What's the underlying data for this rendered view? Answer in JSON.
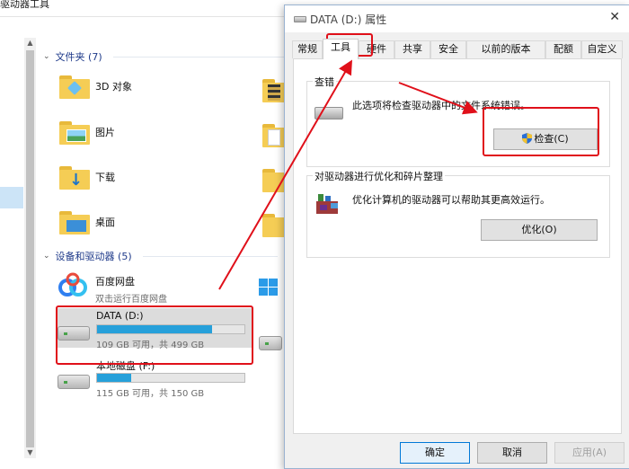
{
  "explorer": {
    "title": "驱动器工具",
    "folders_header": "文件夹 (7)",
    "folders": [
      {
        "label": "3D 对象",
        "icon": "folder-3d-objects-icon"
      },
      {
        "label": "图片",
        "icon": "folder-pictures-icon"
      },
      {
        "label": "下载",
        "icon": "folder-downloads-icon"
      },
      {
        "label": "桌面",
        "icon": "folder-desktop-icon"
      }
    ],
    "devices_header": "设备和驱动器 (5)",
    "netdisk": {
      "name": "百度网盘",
      "sub": "双击运行百度网盘"
    },
    "drives": [
      {
        "name": "DATA (D:)",
        "free_text": "109 GB 可用，共 499 GB",
        "used_fraction": 0.78
      },
      {
        "name": "本地磁盘 (F:)",
        "free_text": "115 GB 可用，共 150 GB",
        "used_fraction": 0.23
      }
    ]
  },
  "dialog": {
    "title": "DATA (D:) 属性",
    "close_symbol": "✕",
    "tabs": [
      "常规",
      "工具",
      "硬件",
      "共享",
      "安全",
      "以前的版本",
      "配额",
      "自定义"
    ],
    "active_tab": "工具",
    "error_check": {
      "title": "查错",
      "description": "此选项将检查驱动器中的文件系统错误。",
      "button": "检查(C)"
    },
    "optimize": {
      "title": "对驱动器进行优化和碎片整理",
      "description": "优化计算机的驱动器可以帮助其更高效运行。",
      "button": "优化(O)"
    },
    "footer": {
      "ok": "确定",
      "cancel": "取消",
      "apply": "应用(A)"
    }
  },
  "colors": {
    "accent": "#26a0da",
    "annotation": "#e0101a",
    "folder": "#f5cd55"
  }
}
